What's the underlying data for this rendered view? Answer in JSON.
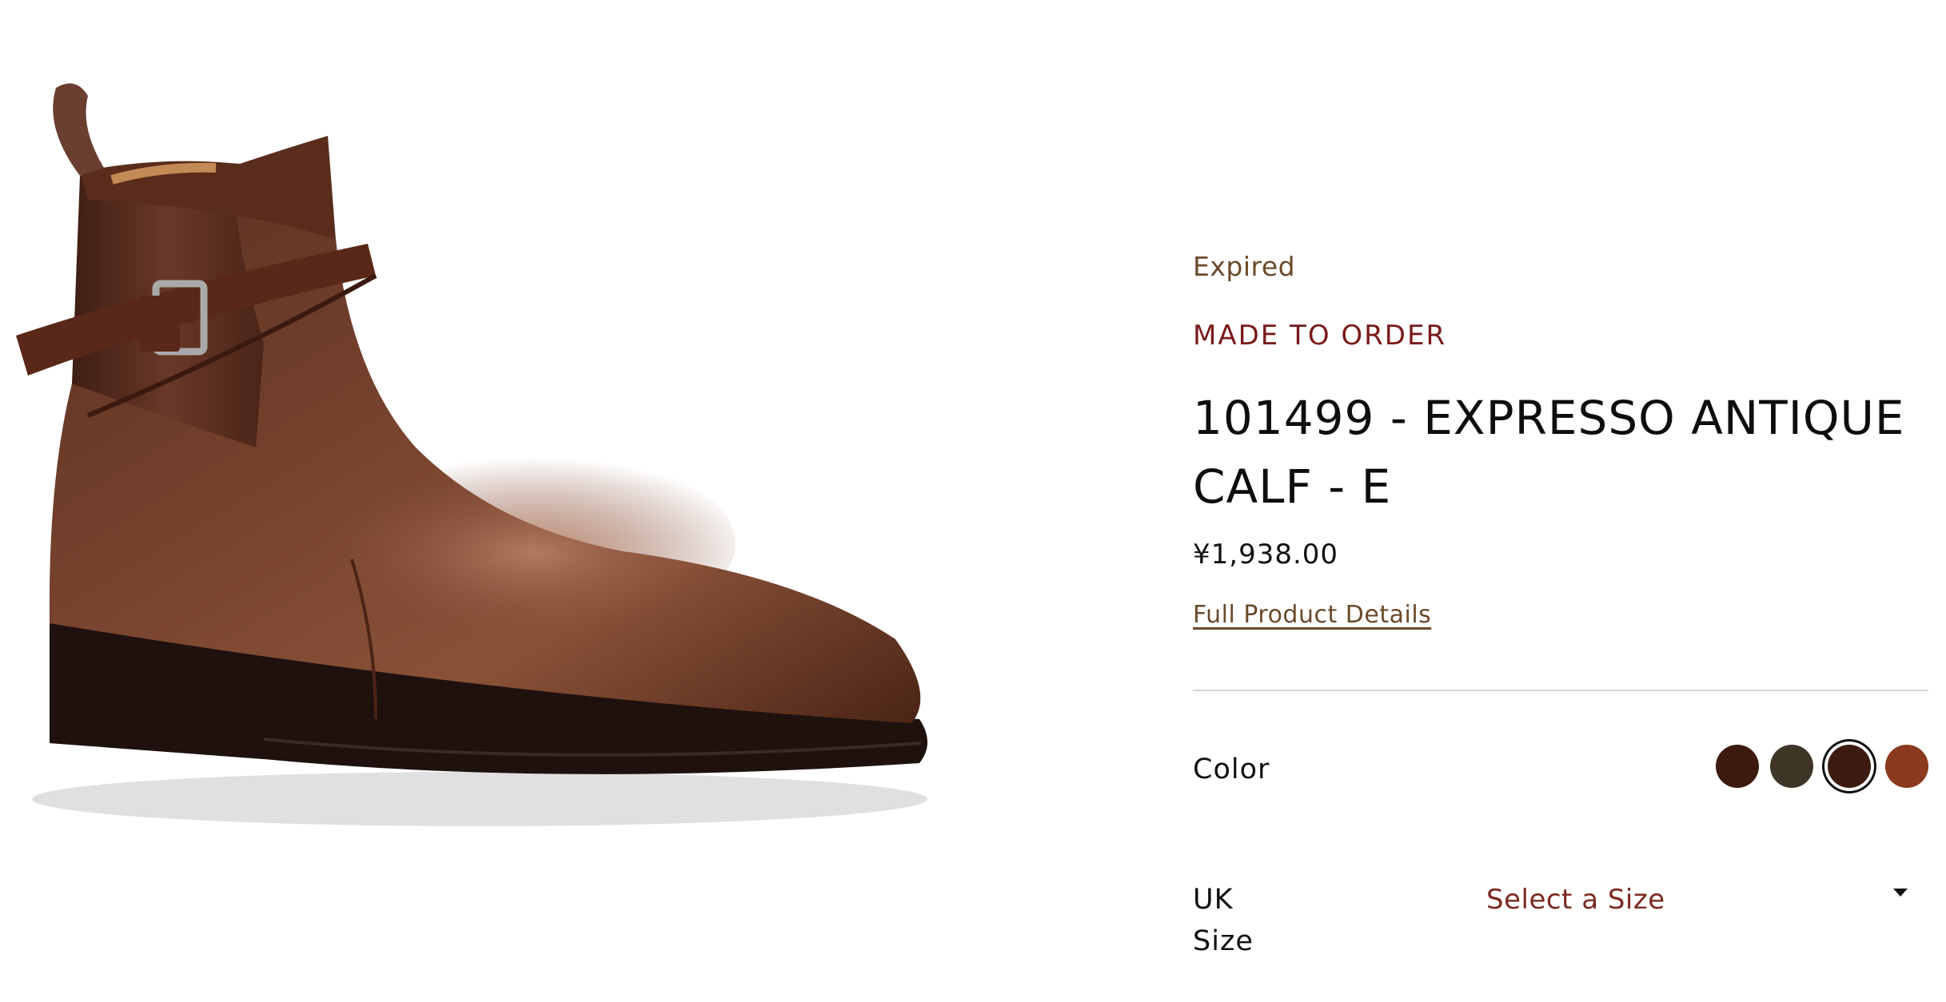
{
  "product": {
    "status": "Expired",
    "tag": "MADE TO ORDER",
    "title": "101499 - EXPRESSO ANTIQUE CALF - E",
    "price": "¥1,938.00",
    "details_link": "Full Product Details",
    "image_icon": "jodhpur-boot-photo"
  },
  "color": {
    "label": "Color",
    "swatches": [
      {
        "color": "#3d1a0e",
        "selected": false
      },
      {
        "color": "#3e3526",
        "selected": false
      },
      {
        "color": "#3b1b10",
        "selected": true
      },
      {
        "color": "#8a3a1e",
        "selected": false
      }
    ]
  },
  "size": {
    "label": "UK Size",
    "placeholder": "Select a Size",
    "icon": "chevron-down-icon"
  }
}
